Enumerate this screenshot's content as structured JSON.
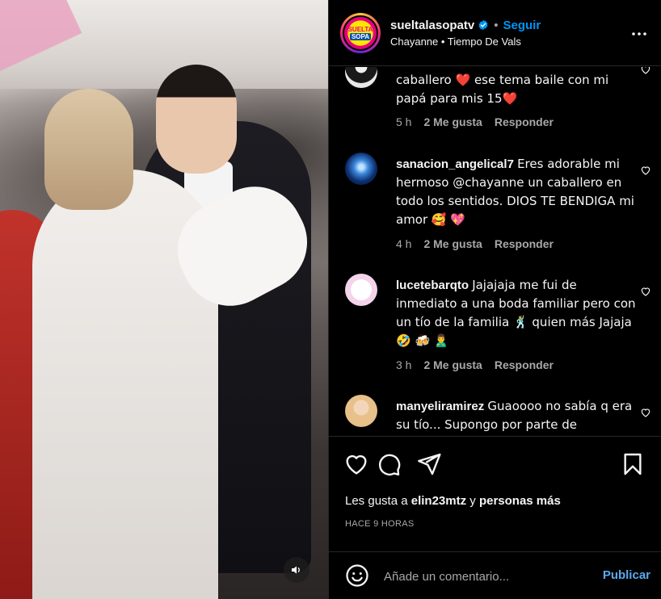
{
  "post": {
    "username": "sueltalasopatv",
    "follow_label": "Seguir",
    "subtitle": "Chayanne • Tiempo De Vals",
    "avatar_text_top": "SUELTA",
    "avatar_text_bottom": "SOPA"
  },
  "comments": [
    {
      "user": "",
      "text": "caballero ❤️  ese tema baile con mi papá para mis 15❤️",
      "time": "5 h",
      "likes": "2 Me gusta",
      "reply": "Responder"
    },
    {
      "user": "sanacion_angelical7",
      "text": "Eres adorable mi hermoso @chayanne un caballero en todo los sentidos. DIOS TE BENDIGA mi amor 🥰 💖",
      "time": "4 h",
      "likes": "2 Me gusta",
      "reply": "Responder"
    },
    {
      "user": "lucetebarqto",
      "text": "Jajajaja me fui de inmediato a una boda familiar pero con un tío de la familia 🕺  quien más Jajaja 🤣 🍻 🙎‍♂️",
      "time": "3 h",
      "likes": "2 Me gusta",
      "reply": "Responder"
    },
    {
      "user": "manyeliramirez",
      "text": "Guaoooo no sabía q era su tío... Supongo por parte de",
      "time": "",
      "likes": "",
      "reply": ""
    }
  ],
  "likes_line": {
    "prefix": "Les gusta a ",
    "user": "elin23mtz",
    "middle": " y ",
    "suffix": "personas más"
  },
  "time_ago": "HACE 9 HORAS",
  "composer": {
    "placeholder": "Añade un comentario...",
    "post_label": "Publicar"
  },
  "icons": {
    "like": "heart-icon",
    "comment": "comment-icon",
    "share": "paper-plane-icon",
    "save": "bookmark-icon",
    "more": "more-horizontal-icon",
    "emoji": "smiley-icon",
    "sound": "speaker-icon",
    "verified": "verified-badge-icon"
  },
  "colors": {
    "accent": "#0095f6",
    "publish": "#5aa9f0",
    "muted_text": "#a8a8a8",
    "heart_red": "#e0245e"
  }
}
